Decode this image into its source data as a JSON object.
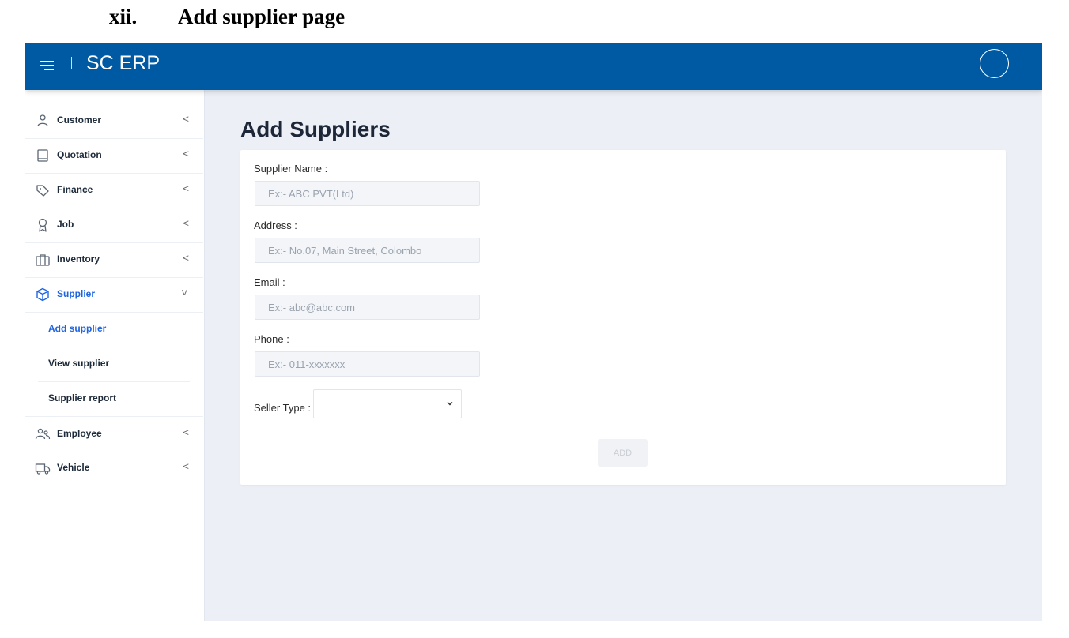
{
  "document": {
    "heading_num": "xii.",
    "heading_title": "Add supplier page"
  },
  "header": {
    "app_title": "SC ERP"
  },
  "sidebar": {
    "items": [
      {
        "label": "Customer",
        "icon": "user-icon"
      },
      {
        "label": "Quotation",
        "icon": "book-icon"
      },
      {
        "label": "Finance",
        "icon": "tag-icon"
      },
      {
        "label": "Job",
        "icon": "award-icon"
      },
      {
        "label": "Inventory",
        "icon": "briefcase-icon"
      },
      {
        "label": "Supplier",
        "icon": "box-icon",
        "expanded": true
      },
      {
        "label": "Employee",
        "icon": "users-icon"
      },
      {
        "label": "Vehicle",
        "icon": "truck-icon"
      }
    ],
    "supplier_sub": [
      "Add supplier",
      "View supplier",
      "Supplier report"
    ],
    "active_item": "Supplier",
    "active_sub": "Add supplier"
  },
  "main": {
    "title": "Add Suppliers",
    "form": {
      "name_label": "Supplier Name :",
      "name_placeholder": "Ex:- ABC PVT(Ltd)",
      "address_label": "Address :",
      "address_placeholder": "Ex:- No.07, Main Street, Colombo",
      "email_label": "Email :",
      "email_placeholder": "Ex:- abc@abc.com",
      "phone_label": "Phone :",
      "phone_placeholder": "Ex:- 011-xxxxxxx",
      "seller_type_label": "Seller Type :",
      "seller_type_value": "",
      "submit_label": "ADD"
    }
  },
  "colors": {
    "header": "#005aa3",
    "accent": "#1f64e0",
    "background": "#eceff6"
  }
}
